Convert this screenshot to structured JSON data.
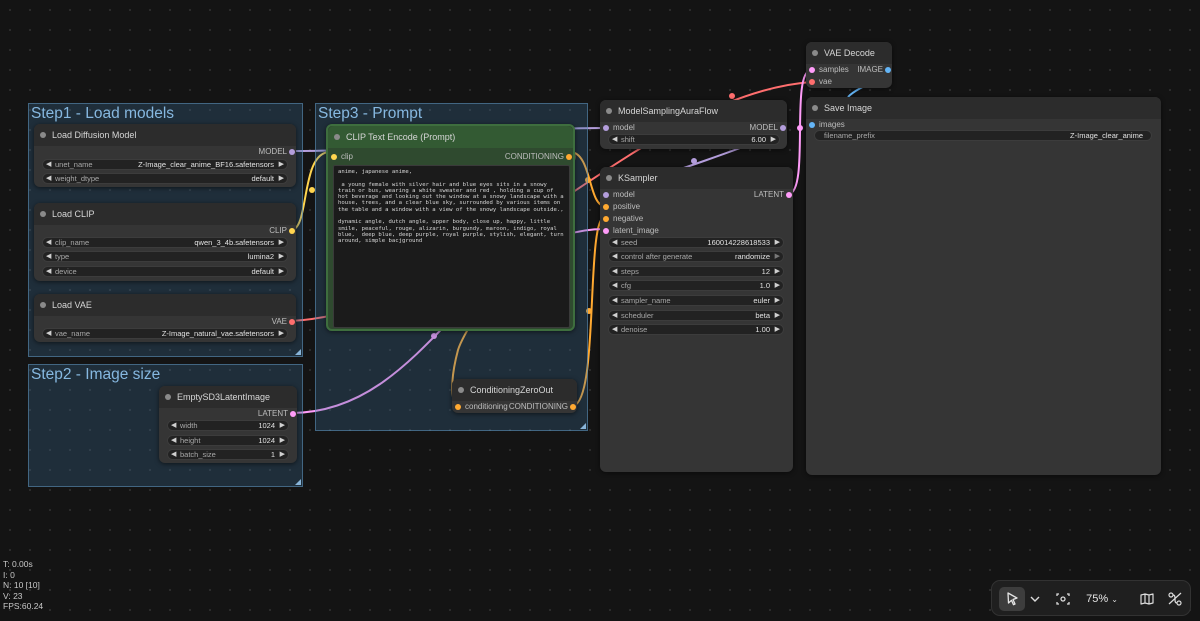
{
  "groups": {
    "step1": "Step1 - Load models",
    "step2": "Step2 - Image size",
    "step3": "Step3 - Prompt"
  },
  "nodes": {
    "load_diffusion": {
      "title": "Load Diffusion Model",
      "output": "MODEL",
      "widgets": [
        {
          "label": "unet_name",
          "value": "Z-Image_clear_anime_BF16.safetensors"
        },
        {
          "label": "weight_dtype",
          "value": "default"
        }
      ]
    },
    "load_clip": {
      "title": "Load CLIP",
      "output": "CLIP",
      "widgets": [
        {
          "label": "clip_name",
          "value": "qwen_3_4b.safetensors"
        },
        {
          "label": "type",
          "value": "lumina2"
        },
        {
          "label": "device",
          "value": "default"
        }
      ]
    },
    "load_vae": {
      "title": "Load VAE",
      "output": "VAE",
      "widgets": [
        {
          "label": "vae_name",
          "value": "Z-Image_natural_vae.safetensors"
        }
      ]
    },
    "empty_latent": {
      "title": "EmptySD3LatentImage",
      "output": "LATENT",
      "widgets": [
        {
          "label": "width",
          "value": "1024"
        },
        {
          "label": "height",
          "value": "1024"
        },
        {
          "label": "batch_size",
          "value": "1"
        }
      ]
    },
    "clip_text": {
      "title": "CLIP Text Encode (Prompt)",
      "input": "clip",
      "output": "CONDITIONING",
      "text": "anime, japanese anime,\n\n a young female with silver hair and blue eyes sits in a snowy train or bus, wearing a white sweater and red , holding a cup of hot beverage and looking out the window at a snowy landscape with a house, trees, and a clear blue sky, surrounded by various items on the table and a window with a view of the snowy landscape outside.,\n\ndynamic angle, dutch angle, upper body, close up, happy, little smile, peaceful, rouge, alizarin, burgundy, maroon, indigo, royal blue,  deep blue, deep purple, royal purple, stylish, elegant, turn around, simple bacjground"
    },
    "zero_out": {
      "title": "ConditioningZeroOut",
      "input": "conditioning",
      "output": "CONDITIONING"
    },
    "aura_flow": {
      "title": "ModelSamplingAuraFlow",
      "input": "model",
      "output": "MODEL",
      "widgets": [
        {
          "label": "shift",
          "value": "6.00"
        }
      ]
    },
    "ksampler": {
      "title": "KSampler",
      "inputs": [
        "model",
        "positive",
        "negative",
        "latent_image"
      ],
      "output": "LATENT",
      "widgets": [
        {
          "label": "seed",
          "value": "160014228618533"
        },
        {
          "label": "control after generate",
          "value": "randomize"
        },
        {
          "label": "steps",
          "value": "12"
        },
        {
          "label": "cfg",
          "value": "1.0"
        },
        {
          "label": "sampler_name",
          "value": "euler"
        },
        {
          "label": "scheduler",
          "value": "beta"
        },
        {
          "label": "denoise",
          "value": "1.00"
        }
      ]
    },
    "vae_decode": {
      "title": "VAE Decode",
      "inputs": [
        "samples",
        "vae"
      ],
      "output": "IMAGE"
    },
    "save_image": {
      "title": "Save Image",
      "input": "images",
      "widgets": [
        {
          "label": "filename_prefix",
          "value": "Z-Image_clear_anime"
        }
      ]
    }
  },
  "stats": {
    "t": "T: 0.00s",
    "i": "I: 0",
    "n": "N: 10 [10]",
    "v": "V: 23",
    "fps": "FPS:60.24"
  },
  "toolbar": {
    "zoom": "75%",
    "icons": [
      "pointer-icon",
      "chevron-down-icon",
      "fit-view-icon",
      "map-icon",
      "link-visibility-icon"
    ]
  },
  "colors": {
    "model": "#b39ddb",
    "clip": "#ffd54f",
    "vae": "#ff6e6e",
    "conditioning": "#ffa931",
    "latent": "#ff9cf9",
    "image": "#64b5f6"
  }
}
